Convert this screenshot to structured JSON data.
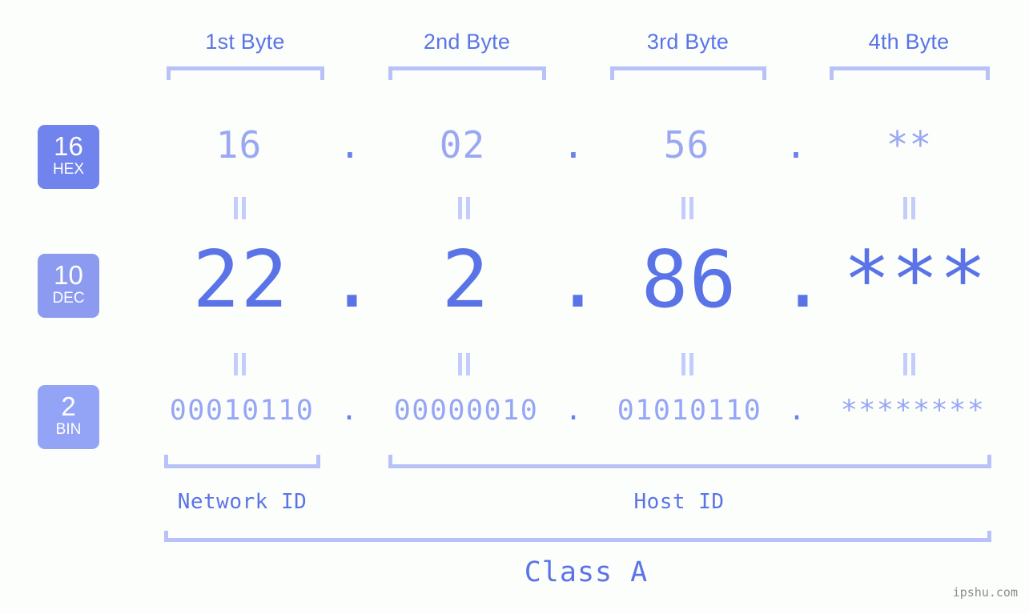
{
  "page": {
    "background": "#fcfefb",
    "accent_strong": "#5a74e8",
    "accent_mid": "#96a6f6",
    "accent_light": "#b8c2f8",
    "watermark": "ipshu.com"
  },
  "byte_headers": [
    {
      "label": "1st Byte"
    },
    {
      "label": "2nd Byte"
    },
    {
      "label": "3rd Byte"
    },
    {
      "label": "4th Byte"
    }
  ],
  "bases": [
    {
      "number": "16",
      "name": "HEX",
      "color": "#7183ec"
    },
    {
      "number": "10",
      "name": "DEC",
      "color": "#8c9bf0"
    },
    {
      "number": "2",
      "name": "BIN",
      "color": "#93a4f6"
    }
  ],
  "rows": {
    "hex": {
      "values": [
        "16",
        "02",
        "56",
        "**"
      ],
      "separator": "."
    },
    "dec": {
      "values": [
        "22",
        "2",
        "86",
        "***"
      ],
      "separator": "."
    },
    "bin": {
      "values": [
        "00010110",
        "00000010",
        "01010110",
        "********"
      ],
      "separator": "."
    }
  },
  "equivalence_symbol": "||",
  "segments": {
    "network_id": "Network ID",
    "host_id": "Host ID",
    "class": "Class A"
  }
}
